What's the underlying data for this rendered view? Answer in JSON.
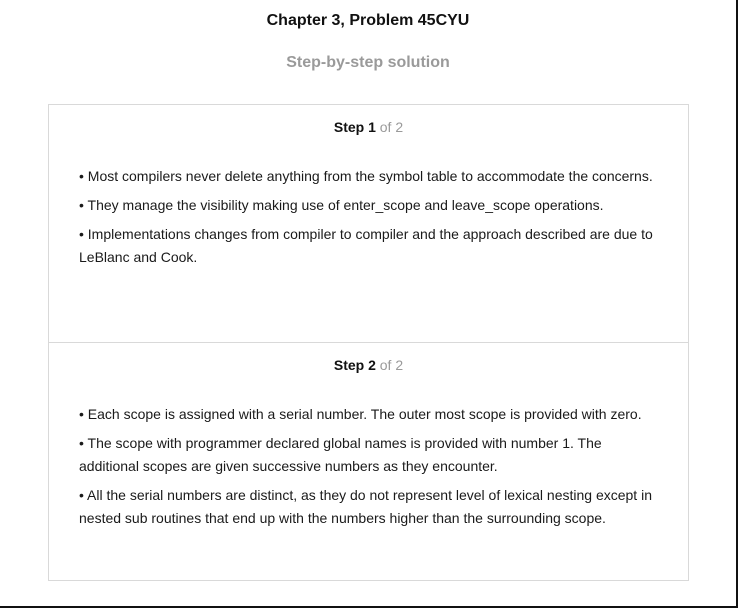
{
  "title": "Chapter 3, Problem 45CYU",
  "subtitle": "Step-by-step solution",
  "steps": [
    {
      "label": "Step 1",
      "of": "of 2",
      "bullets": [
        "• Most compilers never delete anything from the symbol table to accommodate the concerns.",
        "• They manage the visibility making use of enter_scope and leave_scope operations.",
        "• Implementations changes from compiler to compiler and the approach described are due to LeBlanc and Cook."
      ]
    },
    {
      "label": "Step 2",
      "of": "of 2",
      "bullets": [
        "• Each scope is assigned with a serial number. The outer most scope is provided with zero.",
        "• The scope with programmer declared global names is provided with number 1. The additional scopes are given successive numbers as they encounter.",
        "• All the serial numbers are distinct, as they do not represent level of lexical nesting except in nested sub routines that end up with the numbers higher than the surrounding scope."
      ]
    }
  ]
}
